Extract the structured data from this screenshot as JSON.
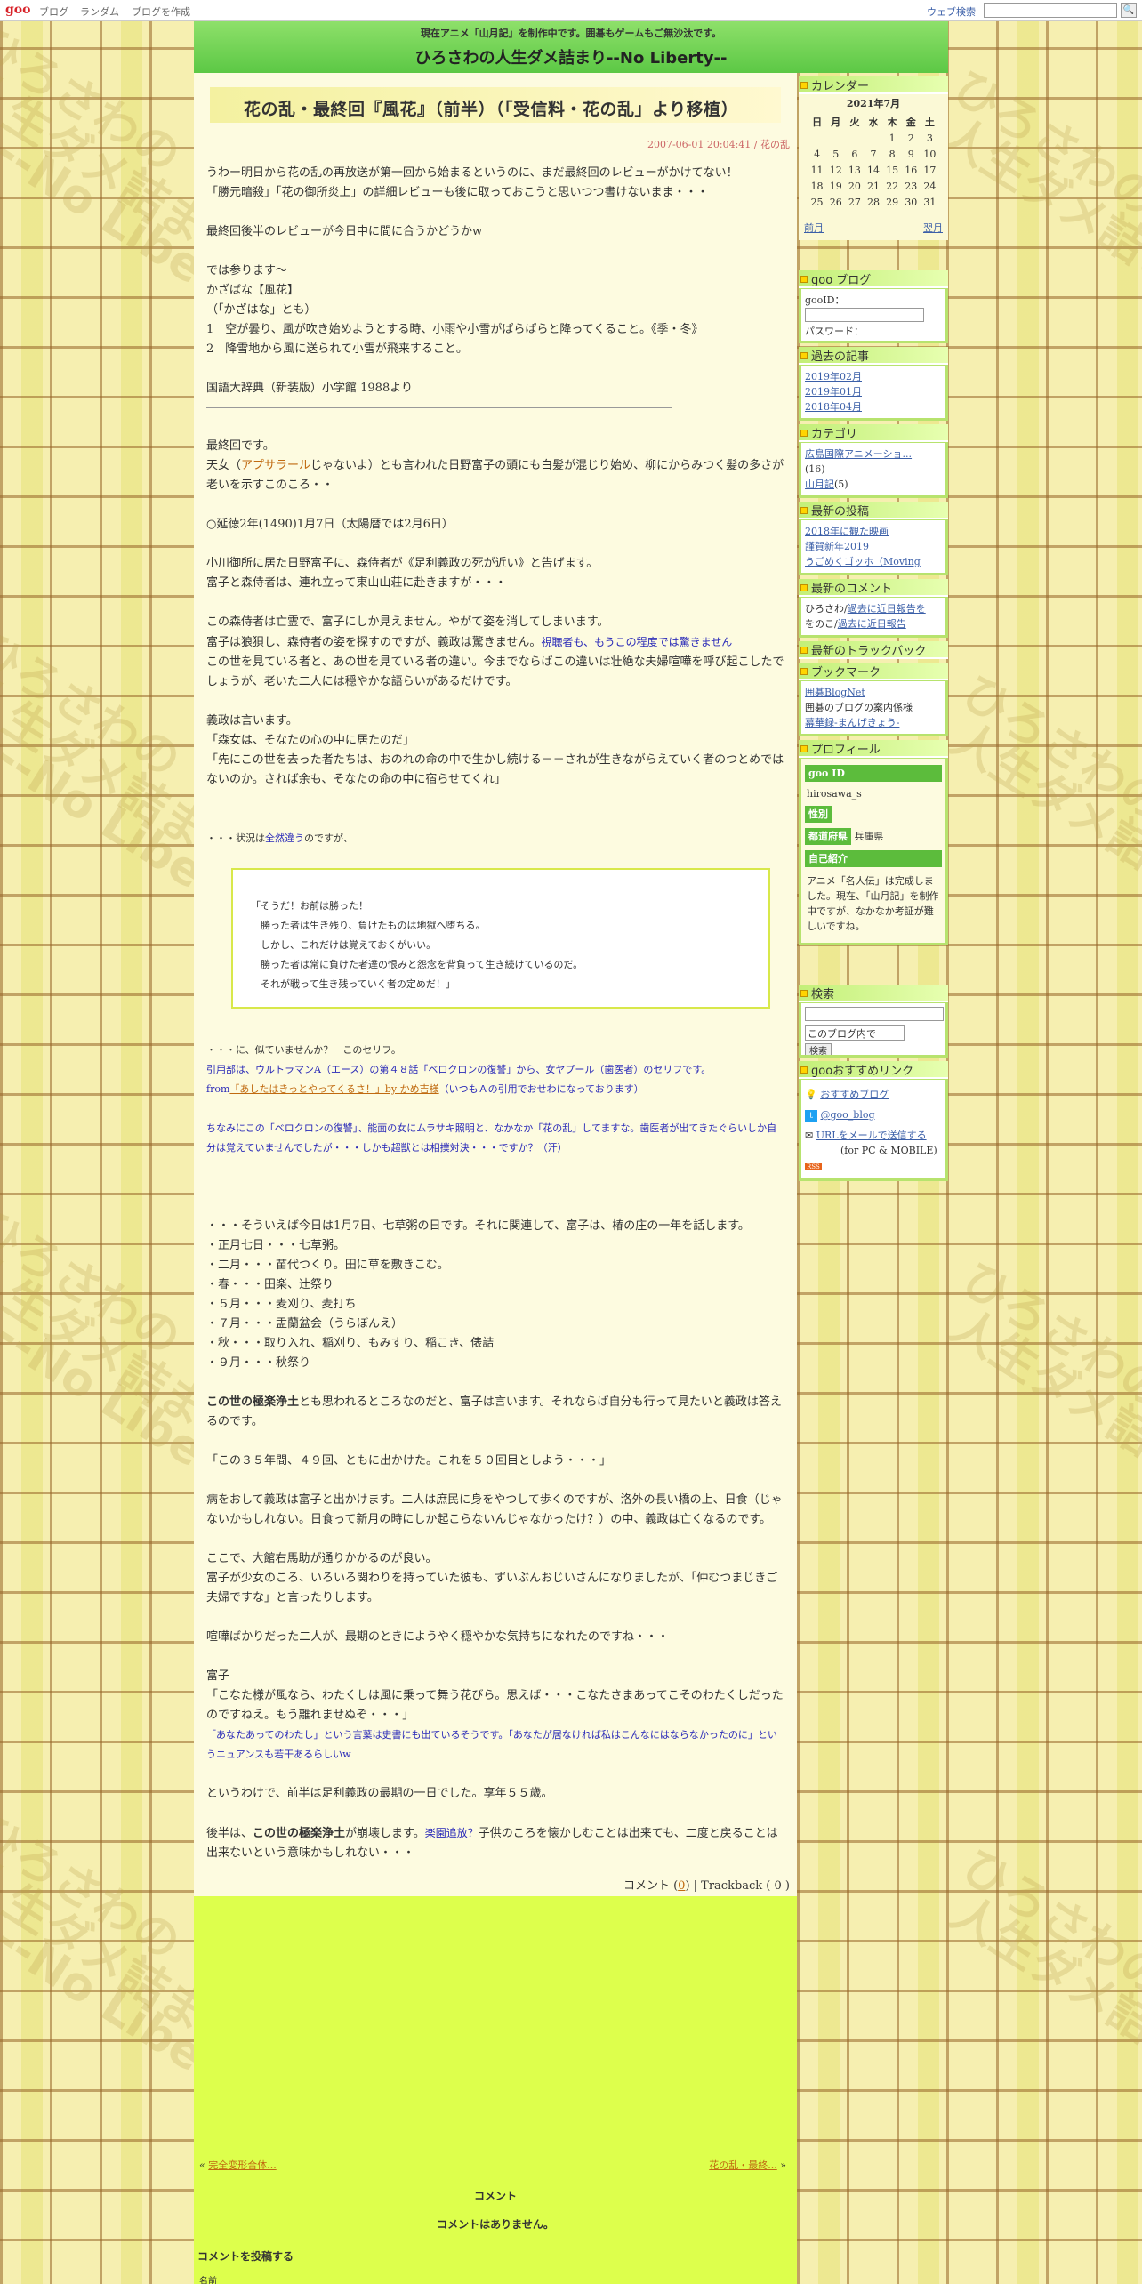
{
  "topbar": {
    "logo": "goo",
    "links": [
      "ブログ",
      "ランダム",
      "ブログを作成"
    ],
    "web_search": "ウェブ検索",
    "search_button": "🔍"
  },
  "header": {
    "subtitle": "現在アニメ「山月記」を制作中です。囲碁もゲームもご無沙汰です。",
    "title": "ひろさわの人生ダメ詰まり--No Liberty--"
  },
  "watermark": [
    "ひろさわの",
    "人生ダメ詰まり",
    "--No Liberty--"
  ],
  "post": {
    "title": "花の乱・最終回『風花』（前半）（「受信料・花の乱」より移植）",
    "date": "2007-06-01 20:04:41",
    "category": "花の乱",
    "p1": "うわー明日から花の乱の再放送が第一回から始まるというのに、まだ最終回のレビューがかけてない！",
    "p2": "「勝元暗殺」「花の御所炎上」の詳細レビューも後に取っておこうと思いつつ書けないまま・・・",
    "p3": "最終回後半のレビューが今日中に間に合うかどうかw",
    "p4": "では参ります～",
    "p5": "かざばな【風花】",
    "p6": "（「かざはな」とも）",
    "p7": "1　空が曇り、風が吹き始めようとする時、小雨や小雪がぱらぱらと降ってくること。《季・冬》",
    "p8": "2　降雪地から風に送られて小雪が飛来すること。",
    "p9": "国語大辞典（新装版）小学館 1988より",
    "p10": "最終回です。",
    "p11a": "天女（",
    "p11link": "アプサラール",
    "p11b": "じゃないよ）とも言われた日野富子の頭にも白髪が混じり始め、柳にからみつく髪の多さが老いを示すこのころ・・",
    "p12": "○延徳2年(1490)1月7日（太陽暦では2月6日）",
    "p13": "小川御所に居た日野富子に、森侍者が《足利義政の死が近い》と告げます。",
    "p14": "富子と森侍者は、連れ立って東山山荘に赴きますが・・・",
    "p15": "この森侍者は亡霊で、富子にしか見えません。やがて姿を消してしまいます。",
    "p16a": "富子は狼狽し、森侍者の姿を探すのですが、義政は驚きません。",
    "p16b": "視聴者も、もうこの程度では驚きません",
    "p17": "この世を見ている者と、あの世を見ている者の違い。今までならばこの違いは壮絶な夫婦喧嘩を呼び起こしたでしょうが、老いた二人には穏やかな語らいがあるだけです。",
    "p18": "義政は言います。",
    "p19": "「森女は、そなたの心の中に居たのだ」",
    "p20": "「先にこの世を去った者たちは、おのれの命の中で生かし続ける－－されが生きながらえていく者のつとめではないのか。されば余も、そなたの命の中に宿らせてくれ」",
    "p21a": "・・・状況は",
    "p21b": "全然違う",
    "p21c": "のですが、",
    "quote": [
      "「そうだ！お前は勝った！",
      "　勝った者は生き残り、負けたものは地獄へ堕ちる。",
      "　しかし、これだけは覚えておくがいい。",
      "　勝った者は常に負けた者達の恨みと怨念を背負って生き続けているのだ。",
      "　それが戦って生き残っていく者の定めだ！」"
    ],
    "p22": "・・・に、似ていませんか？　このセリフ。",
    "p23": "引用部は、ウルトラマンA（エース）の第４８話「ベロクロンの復讐」から、女ヤプール（歯医者）のセリフです。",
    "p24a": "from",
    "p24link": "「あしたはきっとやってくるさ！」by かめ吉様",
    "p24b": "（いつもＡの引用でおせわになっております）",
    "p25": "ちなみにこの「ベロクロンの復讐」、能面の女にムラサキ照明と、なかなか「花の乱」してますな。歯医者が出てきたぐらいしか自分は覚えていませんでしたが・・・しかも超獣とは相撲対決・・・ですか？（汗）",
    "p26": "・・・そういえば今日は1月7日、七草粥の日です。それに関連して、富子は、椿の庄の一年を話します。",
    "list": [
      "・正月七日・・・七草粥。",
      "・二月・・・苗代つくり。田に草を敷きこむ。",
      "・春・・・田楽、辻祭り",
      "・５月・・・麦刈り、麦打ち",
      "・７月・・・盂蘭盆会（うらぼんえ）",
      "・秋・・・取り入れ、稲刈り、もみすり、稲こき、俵詰",
      "・９月・・・秋祭り"
    ],
    "p27bold": "この世の極楽浄土",
    "p27": "とも思われるところなのだと、富子は言います。それならば自分も行って見たいと義政は答えるのです。",
    "p28": "「この３５年間、４９回、ともに出かけた。これを５０回目としよう・・・」",
    "p29": "病をおして義政は富子と出かけます。二人は庶民に身をやつして歩くのですが、洛外の長い橋の上、日食（じゃないかもしれない。日食って新月の時にしか起こらないんじゃなかったけ？）の中、義政は亡くなるのです。",
    "p30": "ここで、大館右馬助が通りかかるのが良い。",
    "p31": "富子が少女のころ、いろいろ関わりを持っていた彼も、ずいぶんおじいさんになりましたが、「仲むつまじきご夫婦ですな」と言ったりします。",
    "p32": "喧嘩ばかりだった二人が、最期のときにようやく穏やかな気持ちになれたのですね・・・",
    "p33": "富子",
    "p34": "「こなた様が風なら、わたくしは風に乗って舞う花びら。思えば・・・こなたさまあってこそのわたくしだったのですねえ。もう離れませぬぞ・・・」",
    "p35": "「あなたあってのわたし」という言葉は史書にも出ているそうです。「あなたが居なければ私はこんなにはならなかったのに」というニュアンスも若干あるらしいw",
    "p36": "というわけで、前半は足利義政の最期の一日でした。享年５５歳。",
    "p37a": "後半は、",
    "p37bold": "この世の極楽浄土",
    "p37b": "が崩壊します。",
    "p37blue": "楽園追放？",
    "p37c": "子供のころを懐かしむことは出来ても、二度と戻ることは出来ないという意味かもしれない・・・",
    "comments_label": "コメント (",
    "comments_count": "0",
    "trackback": ") | Trackback ( 0 )"
  },
  "bottom": {
    "prev_link": "完全変形合体...",
    "next_link": "花の乱・最終...",
    "comments_title": "コメント",
    "no_comments": "コメントはありません。",
    "post_comment": "コメントを投稿する",
    "name_label": "名前"
  },
  "sidebar": {
    "calendar": {
      "title": "カレンダー",
      "month": "2021年7月",
      "weekdays": [
        "日",
        "月",
        "火",
        "水",
        "木",
        "金",
        "土"
      ],
      "weeks": [
        [
          "",
          "",
          "",
          "",
          "1",
          "2",
          "3"
        ],
        [
          "4",
          "5",
          "6",
          "7",
          "8",
          "9",
          "10"
        ],
        [
          "11",
          "12",
          "13",
          "14",
          "15",
          "16",
          "17"
        ],
        [
          "18",
          "19",
          "20",
          "21",
          "22",
          "23",
          "24"
        ],
        [
          "25",
          "26",
          "27",
          "28",
          "29",
          "30",
          "31"
        ]
      ],
      "prev": "前月",
      "next": "翌月"
    },
    "goo_blog": {
      "title": "goo ブログ",
      "id_label": "gooID：",
      "pw_label": "パスワード："
    },
    "archives": {
      "title": "過去の記事",
      "items": [
        "2019年02月",
        "2019年01月",
        "2018年04月"
      ]
    },
    "categories": {
      "title": "カテゴリ",
      "items": [
        {
          "name": "広島国際アニメーショ...",
          "count": "(16)"
        },
        {
          "name": "山月記",
          "count": "(5)"
        }
      ]
    },
    "recent_posts": {
      "title": "最新の投稿",
      "items": [
        "2018年に観た映画",
        "謹賀新年2019",
        "うごめくゴッホ（Moving"
      ]
    },
    "recent_comments": {
      "title": "最新のコメント",
      "items": [
        {
          "who": "ひろさわ/",
          "link": "過去に近日報告を"
        },
        {
          "who": "をのこ/",
          "link": "過去に近日報告"
        }
      ]
    },
    "trackback": {
      "title": "最新のトラックバック"
    },
    "bookmarks": {
      "title": "ブックマーク",
      "items": [
        {
          "name": "囲碁BlogNet",
          "link": true
        },
        {
          "name": "囲碁のブログの案内係様",
          "link": false
        },
        {
          "name": "幕華録-まんげきょう-",
          "link": true
        }
      ]
    },
    "profile": {
      "title": "プロフィール",
      "id_label": "goo ID",
      "id": "hirosawa_s",
      "sex_label": "性別",
      "pref_label": "都道府県",
      "pref": "兵庫県",
      "intro_label": "自己紹介",
      "intro": "アニメ「名人伝」は完成しました。現在、「山月記」を制作中ですが、なかなか考証が難しいですね。"
    },
    "search": {
      "title": "検索",
      "option": "このブログ内で",
      "button": "検索"
    },
    "recommend": {
      "title": "gooおすすめリンク",
      "items": [
        "おすすめブログ",
        "@goo_blog",
        "URLをメールで送信する"
      ],
      "mobile": "(for PC & MOBILE)",
      "rss": "RSS"
    }
  }
}
